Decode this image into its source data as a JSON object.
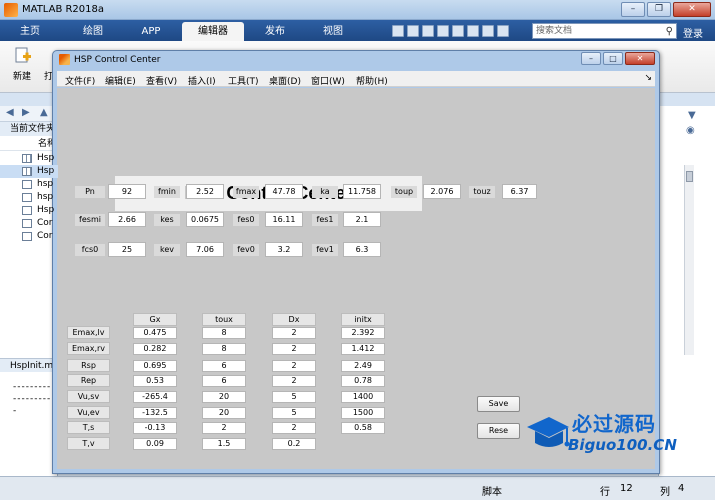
{
  "matlab": {
    "title": "MATLAB R2018a",
    "win_btns": [
      "–",
      "❐",
      "✕"
    ],
    "ribbon_tabs": [
      {
        "label": "主页",
        "active": false
      },
      {
        "label": "绘图",
        "active": false
      },
      {
        "label": "APP",
        "active": false
      },
      {
        "label": "编辑器",
        "active": true
      },
      {
        "label": "发布",
        "active": false
      },
      {
        "label": "视图",
        "active": false
      }
    ],
    "search_placeholder": "搜索文档",
    "login_label": "登录",
    "new_label": "新建",
    "open_label": "打",
    "current_folder_label": "当前文件夹",
    "name_col": "名称",
    "files": [
      {
        "name": "Hsp",
        "icon": "grid"
      },
      {
        "name": "Hsp",
        "icon": "grid"
      },
      {
        "name": "hsp",
        "icon": "doc"
      },
      {
        "name": "hsp",
        "icon": "doc"
      },
      {
        "name": "Hsp",
        "icon": "doc"
      },
      {
        "name": "Cor",
        "icon": "doc"
      },
      {
        "name": "Cor",
        "icon": "doc"
      }
    ],
    "details_label": "HspInit.m",
    "dash_lines": [
      "---------",
      "---------",
      "-"
    ],
    "status": {
      "script": "脚本",
      "row_label": "行",
      "row": "12",
      "col_label": "列",
      "col": "4"
    }
  },
  "figure": {
    "title": "HSP Control Center",
    "win_btns": [
      "–",
      "□",
      "✕"
    ],
    "menus": [
      "文件(F)",
      "编辑(E)",
      "查看(V)",
      "插入(I)",
      "工具(T)",
      "桌面(D)",
      "窗口(W)",
      "帮助(H)"
    ],
    "dock_arrow": "↘",
    "panel_title": "HSP Control Center",
    "params_row1": [
      {
        "label": "Pn",
        "value": "92"
      },
      {
        "label": "fmin",
        "value": "2.52"
      },
      {
        "label": "fmax",
        "value": "47.78"
      },
      {
        "label": "ka",
        "value": "11.758"
      },
      {
        "label": "toup",
        "value": "2.076"
      },
      {
        "label": "touz",
        "value": "6.37"
      }
    ],
    "params_row2": [
      {
        "label": "fesmi",
        "value": "2.66"
      },
      {
        "label": "kes",
        "value": "0.0675"
      },
      {
        "label": "fes0",
        "value": "16.11"
      },
      {
        "label": "fes1",
        "value": "2.1"
      }
    ],
    "params_row3": [
      {
        "label": "fcs0",
        "value": "25"
      },
      {
        "label": "kev",
        "value": "7.06"
      },
      {
        "label": "fev0",
        "value": "3.2"
      },
      {
        "label": "fev1",
        "value": "6.3"
      }
    ],
    "table": {
      "columns": [
        "Gx",
        "toux",
        "Dx",
        "initx"
      ],
      "rows": [
        {
          "label": "Emax,lv",
          "values": [
            "0.475",
            "8",
            "2",
            "2.392"
          ]
        },
        {
          "label": "Emax,rv",
          "values": [
            "0.282",
            "8",
            "2",
            "1.412"
          ]
        },
        {
          "label": "Rsp",
          "values": [
            "0.695",
            "6",
            "2",
            "2.49"
          ]
        },
        {
          "label": "Rep",
          "values": [
            "0.53",
            "6",
            "2",
            "0.78"
          ]
        },
        {
          "label": "Vu,sv",
          "values": [
            "-265.4",
            "20",
            "5",
            "1400"
          ]
        },
        {
          "label": "Vu,ev",
          "values": [
            "-132.5",
            "20",
            "5",
            "1500"
          ]
        },
        {
          "label": "T,s",
          "values": [
            "-0.13",
            "2",
            "2",
            "0.58"
          ]
        },
        {
          "label": "T,v",
          "values": [
            "0.09",
            "1.5",
            "0.2",
            ""
          ]
        }
      ]
    },
    "save_label": "Save",
    "reset_label": "Rese"
  },
  "watermark": {
    "text_cn": "必过源码",
    "text_en": "Biguo100.CN"
  }
}
